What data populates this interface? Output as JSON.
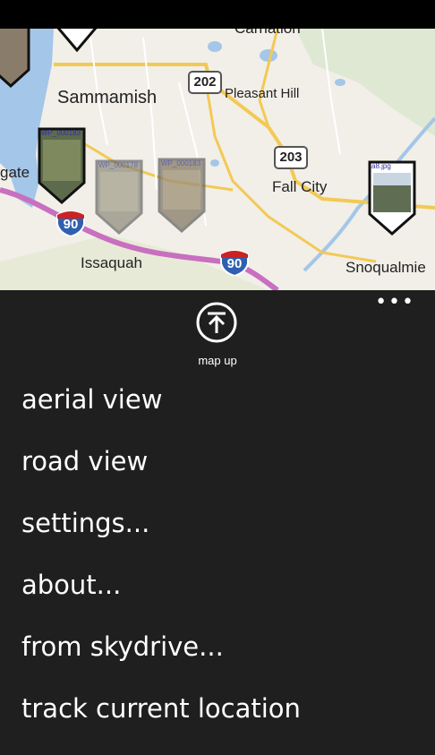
{
  "map": {
    "places": {
      "carnation": "Carnation",
      "sammamish": "Sammamish",
      "pleasant_hill": "Pleasant Hill",
      "fall_city": "Fall City",
      "issaquah": "Issaquah",
      "snoqualmie": "Snoqualmie",
      "gate": "gate"
    },
    "highways": {
      "hwy202": "202",
      "hwy203": "203",
      "i90_west": "90",
      "i90_east": "90"
    },
    "pins": [
      {
        "label": "WP_000183 99"
      },
      {
        "label": "WP_000178"
      },
      {
        "label": "WP_000183"
      },
      {
        "label": "a8.jpg"
      }
    ],
    "colors": {
      "water": "#a4c6e8",
      "interstate": "#c86fc0",
      "road": "#f3c955",
      "land": "#f1efe8",
      "park": "#cfe3c4"
    }
  },
  "appbar": {
    "more_icon": "ellipsis-icon",
    "mapup_icon": "arrow-up-to-line-icon",
    "mapup_label": "map up",
    "menu": [
      {
        "label": "aerial view"
      },
      {
        "label": "road view"
      },
      {
        "label": "settings..."
      },
      {
        "label": "about..."
      },
      {
        "label": "from skydrive..."
      },
      {
        "label": "track current location"
      }
    ]
  }
}
